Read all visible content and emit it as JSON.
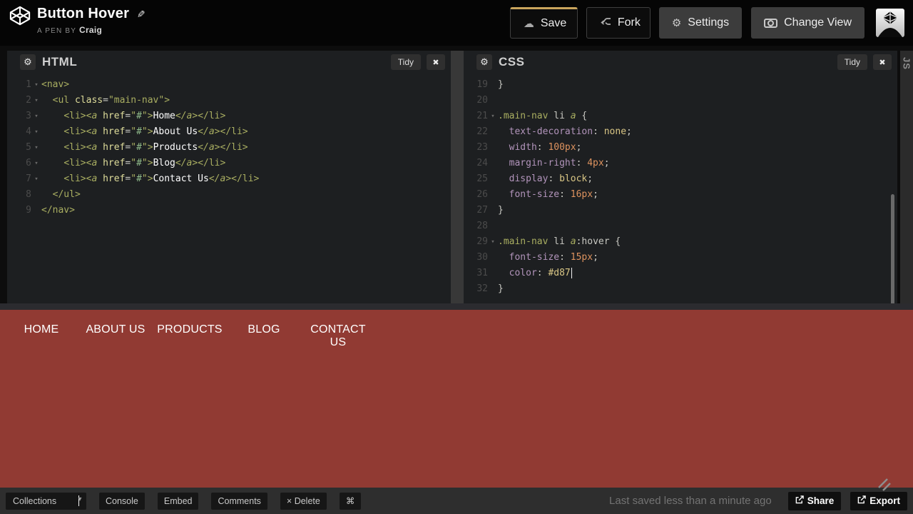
{
  "header": {
    "title": "Button Hover",
    "byline_prefix": "A PEN BY",
    "author": "Craig",
    "save_label": "Save",
    "fork_label": "Fork",
    "settings_label": "Settings",
    "change_view_label": "Change View"
  },
  "icons": {
    "pencil": "✎",
    "cloud": "☁",
    "gear": "⚙",
    "close": "✖",
    "caret_down": "▾",
    "fold": "▾"
  },
  "colors": {
    "accent_gold": "#c9a45c",
    "preview_background": "#913a33",
    "editor_background": "#1d1f21",
    "header_background": "#050505",
    "footer_background": "#2e2e2e"
  },
  "panels": {
    "js_label": "JS",
    "html": {
      "title": "HTML",
      "tidy_label": "Tidy",
      "lines": [
        {
          "n": "1",
          "fold": true,
          "segs": [
            [
              "tag",
              "<nav>"
            ]
          ]
        },
        {
          "n": "2",
          "fold": true,
          "segs": [
            [
              "ws",
              "  "
            ],
            [
              "tag",
              "<ul"
            ],
            [
              "ws",
              " "
            ],
            [
              "attr",
              "class"
            ],
            [
              "pun",
              "="
            ],
            [
              "str",
              "\"main-nav\""
            ],
            [
              "tag",
              ">"
            ]
          ]
        },
        {
          "n": "3",
          "fold": true,
          "segs": [
            [
              "ws",
              "    "
            ],
            [
              "tag",
              "<li>"
            ],
            [
              "tagi",
              "<a"
            ],
            [
              "ws",
              " "
            ],
            [
              "attr",
              "href"
            ],
            [
              "pun",
              "="
            ],
            [
              "str",
              "\""
            ],
            [
              "hash",
              "#"
            ],
            [
              "str",
              "\""
            ],
            [
              "tag",
              ">"
            ],
            [
              "txt",
              "Home"
            ],
            [
              "tagi",
              "</a>"
            ],
            [
              "tag",
              "</li>"
            ]
          ]
        },
        {
          "n": "4",
          "fold": true,
          "segs": [
            [
              "ws",
              "    "
            ],
            [
              "tag",
              "<li>"
            ],
            [
              "tagi",
              "<a"
            ],
            [
              "ws",
              " "
            ],
            [
              "attr",
              "href"
            ],
            [
              "pun",
              "="
            ],
            [
              "str",
              "\""
            ],
            [
              "hash",
              "#"
            ],
            [
              "str",
              "\""
            ],
            [
              "tag",
              ">"
            ],
            [
              "txt",
              "About Us"
            ],
            [
              "tagi",
              "</a>"
            ],
            [
              "tag",
              "</li>"
            ]
          ]
        },
        {
          "n": "5",
          "fold": true,
          "segs": [
            [
              "ws",
              "    "
            ],
            [
              "tag",
              "<li>"
            ],
            [
              "tagi",
              "<a"
            ],
            [
              "ws",
              " "
            ],
            [
              "attr",
              "href"
            ],
            [
              "pun",
              "="
            ],
            [
              "str",
              "\""
            ],
            [
              "hash",
              "#"
            ],
            [
              "str",
              "\""
            ],
            [
              "tag",
              ">"
            ],
            [
              "txt",
              "Products"
            ],
            [
              "tagi",
              "</a>"
            ],
            [
              "tag",
              "</li>"
            ]
          ]
        },
        {
          "n": "6",
          "fold": true,
          "segs": [
            [
              "ws",
              "    "
            ],
            [
              "tag",
              "<li>"
            ],
            [
              "tagi",
              "<a"
            ],
            [
              "ws",
              " "
            ],
            [
              "attr",
              "href"
            ],
            [
              "pun",
              "="
            ],
            [
              "str",
              "\""
            ],
            [
              "hash",
              "#"
            ],
            [
              "str",
              "\""
            ],
            [
              "tag",
              ">"
            ],
            [
              "txt",
              "Blog"
            ],
            [
              "tagi",
              "</a>"
            ],
            [
              "tag",
              "</li>"
            ]
          ]
        },
        {
          "n": "7",
          "fold": true,
          "segs": [
            [
              "ws",
              "    "
            ],
            [
              "tag",
              "<li>"
            ],
            [
              "tagi",
              "<a"
            ],
            [
              "ws",
              " "
            ],
            [
              "attr",
              "href"
            ],
            [
              "pun",
              "="
            ],
            [
              "str",
              "\""
            ],
            [
              "hash",
              "#"
            ],
            [
              "str",
              "\""
            ],
            [
              "tag",
              ">"
            ],
            [
              "txt",
              "Contact Us"
            ],
            [
              "tagi",
              "</a>"
            ],
            [
              "tag",
              "</li>"
            ]
          ]
        },
        {
          "n": "8",
          "fold": false,
          "segs": [
            [
              "ws",
              "  "
            ],
            [
              "tag",
              "</ul>"
            ]
          ]
        },
        {
          "n": "9",
          "fold": false,
          "segs": [
            [
              "tag",
              "</nav>"
            ]
          ]
        }
      ]
    },
    "css": {
      "title": "CSS",
      "tidy_label": "Tidy",
      "lines": [
        {
          "n": "19",
          "fold": false,
          "segs": [
            [
              "plain",
              "}"
            ]
          ]
        },
        {
          "n": "20",
          "fold": false,
          "segs": []
        },
        {
          "n": "21",
          "fold": true,
          "segs": [
            [
              "tag",
              ".main-nav"
            ],
            [
              "ws",
              " "
            ],
            [
              "plain",
              "li"
            ],
            [
              "ws",
              " "
            ],
            [
              "tagi",
              "a"
            ],
            [
              "ws",
              " "
            ],
            [
              "plain",
              "{"
            ]
          ]
        },
        {
          "n": "22",
          "fold": false,
          "segs": [
            [
              "ws",
              "  "
            ],
            [
              "prop",
              "text-decoration"
            ],
            [
              "plain",
              ": "
            ],
            [
              "val",
              "none"
            ],
            [
              "plain",
              ";"
            ]
          ]
        },
        {
          "n": "23",
          "fold": false,
          "segs": [
            [
              "ws",
              "  "
            ],
            [
              "prop",
              "width"
            ],
            [
              "plain",
              ": "
            ],
            [
              "num",
              "100px"
            ],
            [
              "plain",
              ";"
            ]
          ]
        },
        {
          "n": "24",
          "fold": false,
          "segs": [
            [
              "ws",
              "  "
            ],
            [
              "prop",
              "margin-right"
            ],
            [
              "plain",
              ": "
            ],
            [
              "num",
              "4px"
            ],
            [
              "plain",
              ";"
            ]
          ]
        },
        {
          "n": "25",
          "fold": false,
          "segs": [
            [
              "ws",
              "  "
            ],
            [
              "prop",
              "display"
            ],
            [
              "plain",
              ": "
            ],
            [
              "val",
              "block"
            ],
            [
              "plain",
              ";"
            ]
          ]
        },
        {
          "n": "26",
          "fold": false,
          "segs": [
            [
              "ws",
              "  "
            ],
            [
              "prop",
              "font-size"
            ],
            [
              "plain",
              ": "
            ],
            [
              "num",
              "16px"
            ],
            [
              "plain",
              ";"
            ]
          ]
        },
        {
          "n": "27",
          "fold": false,
          "segs": [
            [
              "plain",
              "}"
            ]
          ]
        },
        {
          "n": "28",
          "fold": false,
          "segs": []
        },
        {
          "n": "29",
          "fold": true,
          "segs": [
            [
              "tag",
              ".main-nav"
            ],
            [
              "ws",
              " "
            ],
            [
              "plain",
              "li"
            ],
            [
              "ws",
              " "
            ],
            [
              "tagi",
              "a"
            ],
            [
              "plain",
              ":hover {"
            ]
          ]
        },
        {
          "n": "30",
          "fold": false,
          "segs": [
            [
              "ws",
              "  "
            ],
            [
              "prop",
              "font-size"
            ],
            [
              "plain",
              ": "
            ],
            [
              "num",
              "15px"
            ],
            [
              "plain",
              ";"
            ]
          ]
        },
        {
          "n": "31",
          "fold": false,
          "segs": [
            [
              "ws",
              "  "
            ],
            [
              "prop",
              "color"
            ],
            [
              "plain",
              ": "
            ],
            [
              "val",
              "#d87"
            ],
            [
              "cursor",
              ""
            ]
          ]
        },
        {
          "n": "32",
          "fold": false,
          "segs": [
            [
              "plain",
              "}"
            ]
          ]
        }
      ]
    }
  },
  "preview": {
    "nav_items": [
      "HOME",
      "ABOUT US",
      "PRODUCTS",
      "BLOG",
      "CONTACT US"
    ]
  },
  "footer": {
    "collections_label": "Collections",
    "buttons": [
      "Console",
      "Embed",
      "Comments",
      "× Delete",
      "⌘"
    ],
    "last_saved": "Last saved less than a minute ago",
    "share_label": "Share",
    "export_label": "Export"
  }
}
